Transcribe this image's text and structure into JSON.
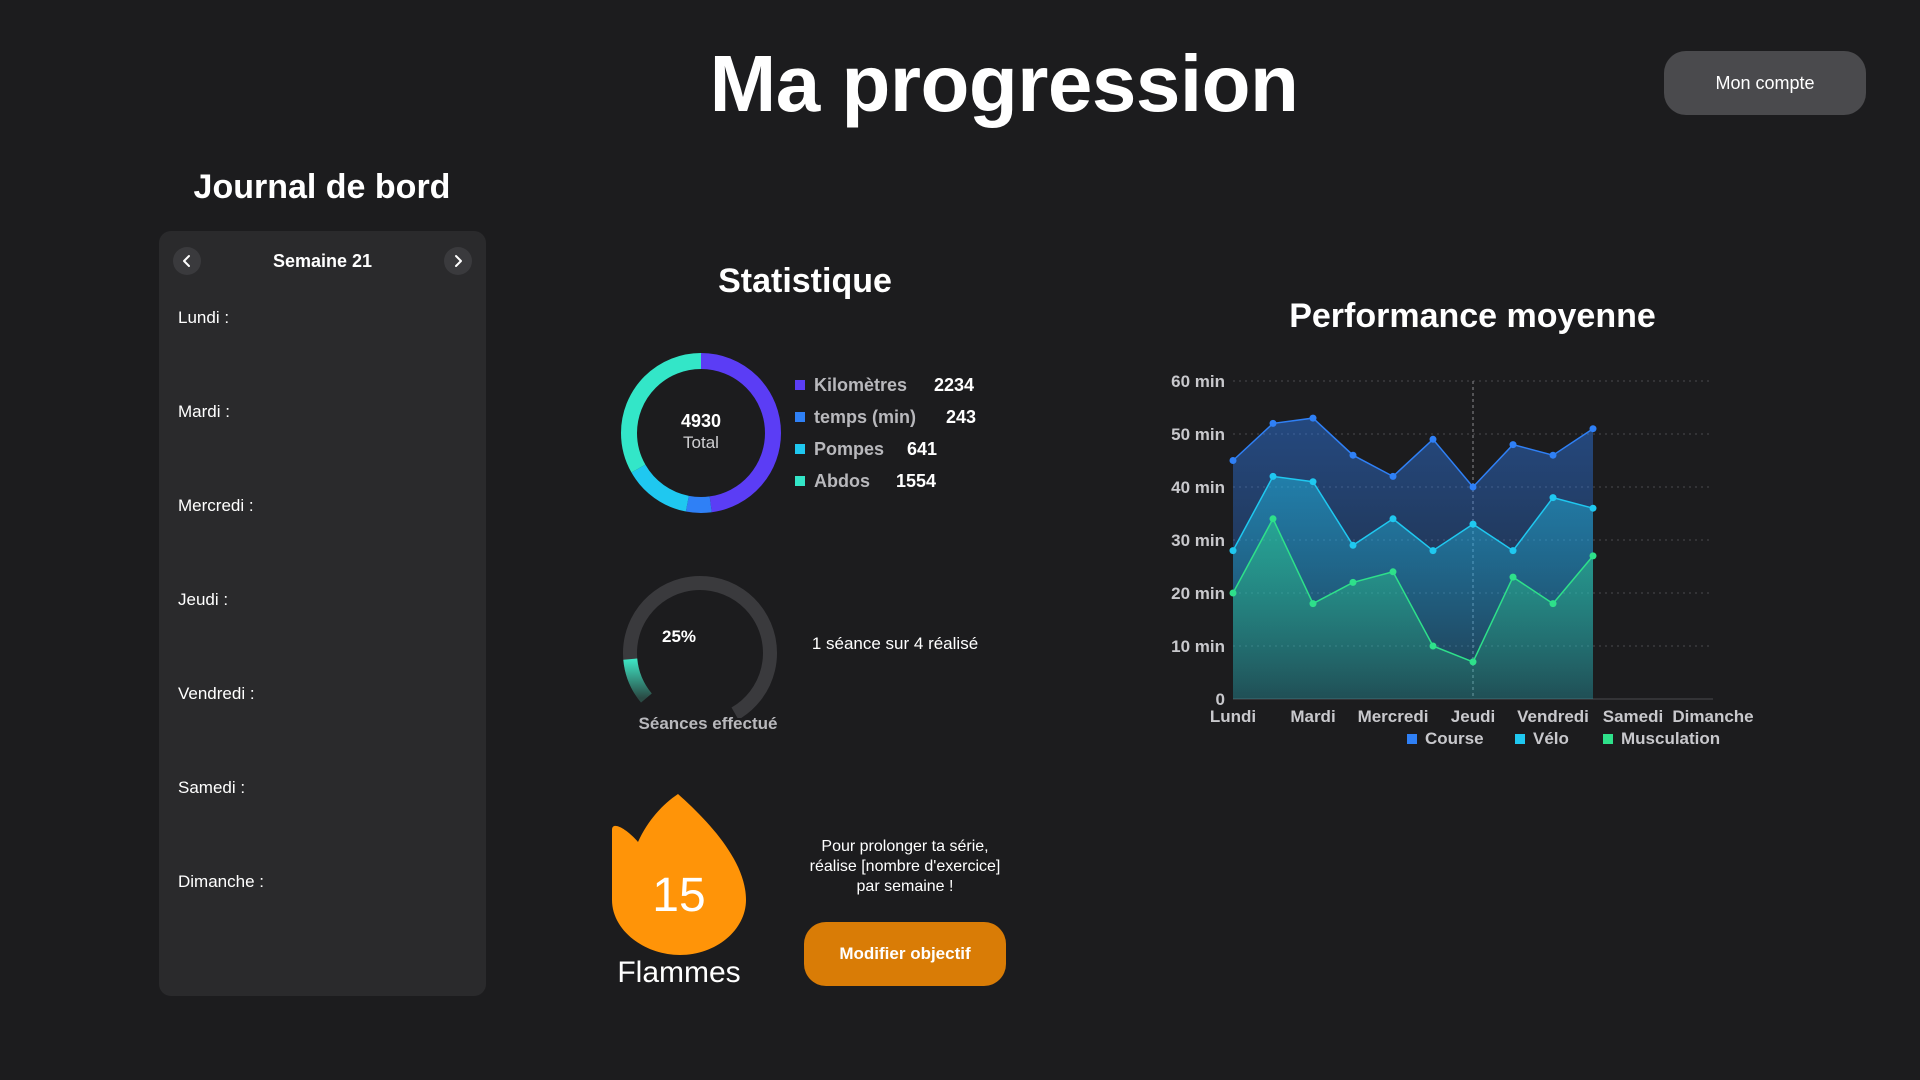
{
  "header": {
    "title": "Ma progression",
    "account_label": "Mon compte"
  },
  "journal": {
    "title": "Journal de bord",
    "week_label": "Semaine 21",
    "prev_icon": "chevron-left-icon",
    "next_icon": "chevron-right-icon",
    "days": [
      "Lundi :",
      "Mardi :",
      "Mercredi :",
      "Jeudi :",
      "Vendredi :",
      "Samedi :",
      "Dimanche :"
    ]
  },
  "stats": {
    "title": "Statistique",
    "donut": {
      "total_value": "4930",
      "total_label": "Total",
      "items": [
        {
          "label": "Kilomètres",
          "value": "2234",
          "color": "#5b3df5"
        },
        {
          "label": "temps (min)",
          "value": "243",
          "color": "#2f80f6"
        },
        {
          "label": "Pompes",
          "value": "641",
          "color": "#1fc8f0"
        },
        {
          "label": "Abdos",
          "value": "1554",
          "color": "#33e6c8"
        }
      ]
    },
    "sessions": {
      "percent_text": "25%",
      "percent": 25,
      "label": "Séances effectué",
      "summary": "1 séance sur 4 réalisé"
    },
    "streak": {
      "count": "15",
      "label": "Flammes",
      "message_lines": [
        "Pour prolonger ta série,",
        "réalise [nombre d'exercice]",
        "par semaine !"
      ],
      "button_label": "Modifier objectif",
      "color": "#ff9408"
    }
  },
  "chart_data": {
    "type": "area",
    "title": "Performance moyenne",
    "categories": [
      "Lundi",
      "Mardi",
      "Mercredi",
      "Jeudi",
      "Vendredi",
      "Samedi",
      "Dimanche"
    ],
    "x_positions": [
      0,
      0.5,
      1,
      1.5,
      2,
      2.5,
      3,
      3.5,
      4,
      4.5,
      5,
      5.5,
      6
    ],
    "ylim": [
      0,
      60
    ],
    "y_ticks": [
      "0",
      "10 min",
      "20 min",
      "30 min",
      "40 min",
      "50 min",
      "60 min"
    ],
    "grid": true,
    "legend_position": "bottom",
    "series": [
      {
        "name": "Course",
        "color": "#2f80f6",
        "values": [
          45,
          52,
          53,
          46,
          42,
          49,
          40,
          48,
          46,
          51
        ]
      },
      {
        "name": "Vélo",
        "color": "#1fc8f0",
        "values": [
          28,
          42,
          41,
          29,
          34,
          28,
          33,
          28,
          38,
          36
        ]
      },
      {
        "name": "Musculation",
        "color": "#2ee08a",
        "values": [
          20,
          34,
          18,
          22,
          24,
          10,
          7,
          23,
          18,
          27
        ]
      }
    ]
  }
}
